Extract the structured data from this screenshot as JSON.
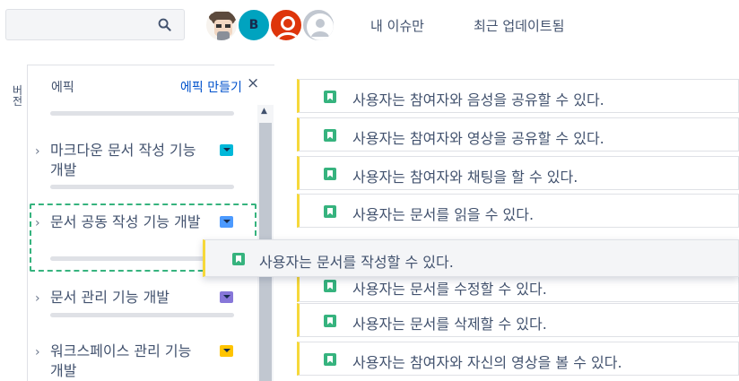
{
  "search": {
    "placeholder": ""
  },
  "avatars": [
    {
      "name": "avatar-character",
      "initial": ""
    },
    {
      "name": "avatar-b",
      "initial": "B"
    },
    {
      "name": "avatar-red",
      "initial": ""
    },
    {
      "name": "avatar-default",
      "initial": ""
    }
  ],
  "quick_filters": [
    "내 이슈만",
    "최근 업데이트됨"
  ],
  "side_tab": "버전",
  "epic_panel": {
    "title": "에픽",
    "create_label": "에픽 만들기",
    "close_icon": "×",
    "epics": [
      {
        "title": "마크다운 문서 작성 기능 개발",
        "color": "#00b8d9"
      },
      {
        "title": "문서 공동 작성 기능 개발",
        "color": "#4c9aff"
      },
      {
        "title": "문서 관리 기능 개발",
        "color": "#8777d9"
      },
      {
        "title": "워크스페이스 관리 기능 개발",
        "color": "#ffc400"
      }
    ]
  },
  "backlog": {
    "items": [
      "사용자는 참여자와 음성을 공유할 수 있다.",
      "사용자는 참여자와 영상을 공유할 수 있다.",
      "사용자는 참여자와 채팅을 할 수 있다.",
      "사용자는 문서를 읽을 수 있다.",
      "사용자는 문서를 수정할 수 있다.",
      "사용자는 문서를 삭제할 수 있다.",
      "사용자는 참여자와 자신의 영상을 볼 수 있다."
    ],
    "dragging_item": "사용자는 문서를 작성할 수 있다."
  },
  "colors": {
    "story": "#36b37e",
    "epic_bar": "#f6d83a",
    "link": "#0052cc"
  }
}
